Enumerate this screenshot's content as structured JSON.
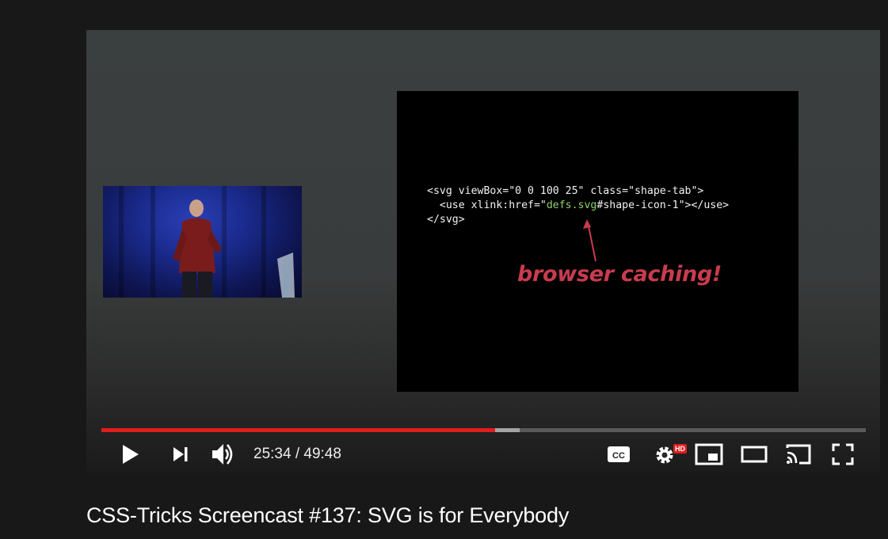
{
  "video": {
    "title": "CSS-Tricks Screencast #137: SVG is for Everybody"
  },
  "slide": {
    "code_line1": "<svg viewBox=\"0 0 100 25\" class=\"shape-tab\">",
    "code_line2_prefix": "  <use xlink:href=\"",
    "code_line2_highlight": "defs.svg",
    "code_line2_suffix": "#shape-icon-1\"></use>",
    "code_line3": "</svg>",
    "annotation": "browser caching!"
  },
  "player": {
    "time_display": "25:34 / 49:48",
    "progress_played": 0.515,
    "progress_buffered": 0.547,
    "quality_badge": "HD",
    "cc_label": "CC"
  },
  "icons": [
    "play-icon",
    "next-icon",
    "volume-icon",
    "cc-icon",
    "settings-icon",
    "miniplayer-icon",
    "theater-icon",
    "cast-icon",
    "fullscreen-icon"
  ],
  "colors": {
    "progress_red": "#e11d1d",
    "annotation_red": "#c83c4e",
    "code_highlight": "#8fd16a"
  }
}
